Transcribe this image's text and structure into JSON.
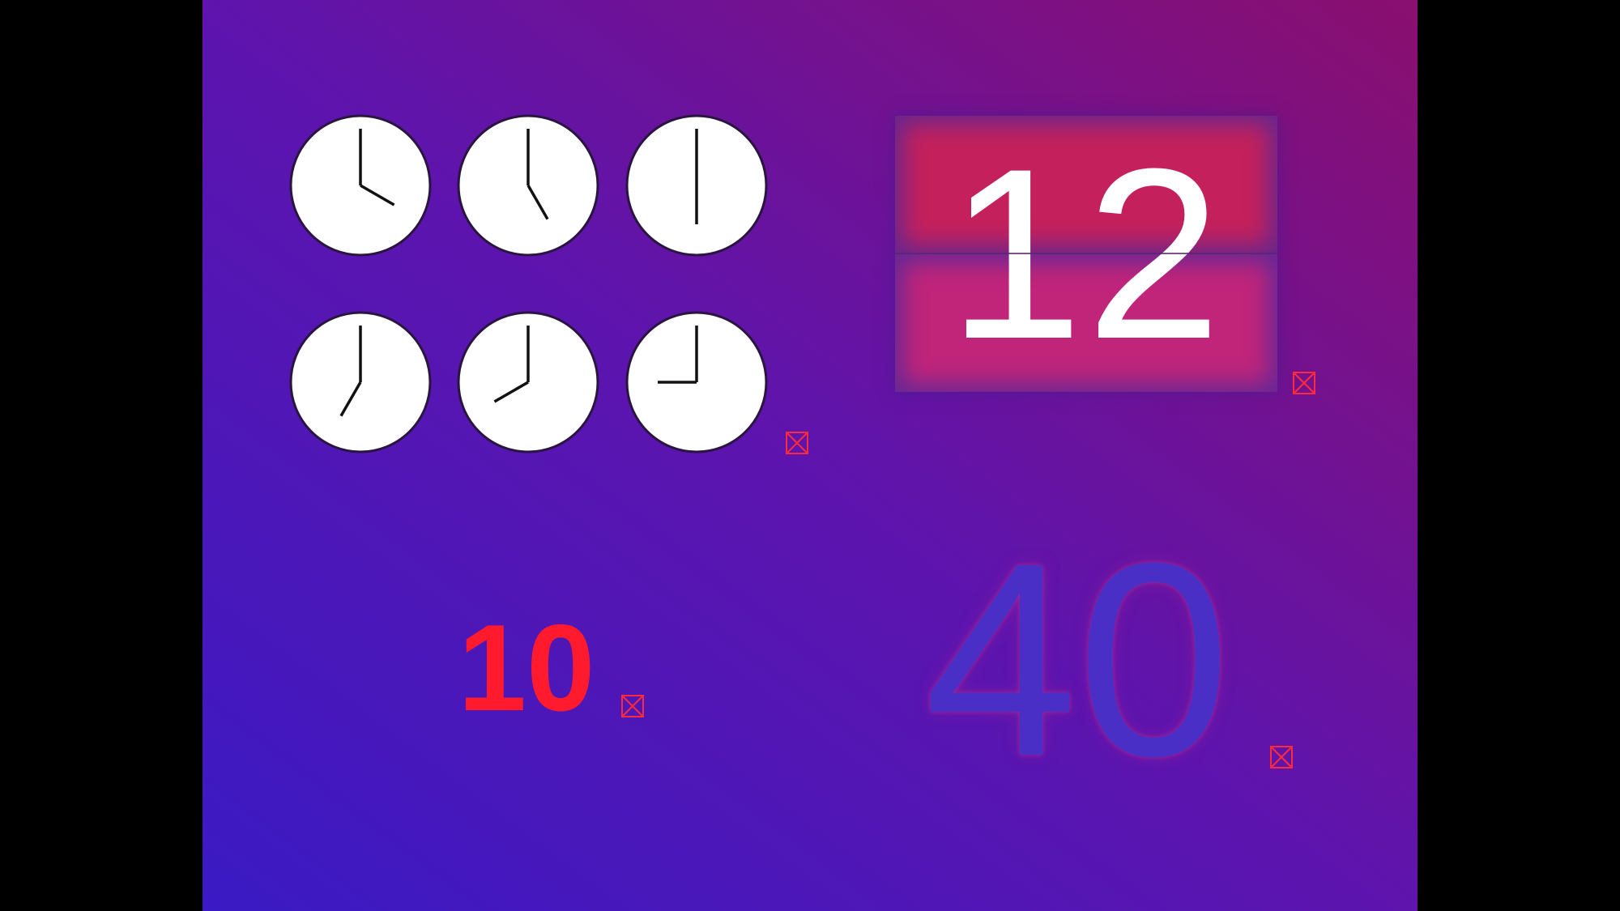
{
  "colors": {
    "letterbox": "#000000",
    "gradient_start": "#3a1ac4",
    "gradient_mid": "#5e14ad",
    "gradient_end": "#8a0f6f",
    "clock_face": "#ffffff",
    "clock_rim": "#2a1440",
    "clock_hand": "#111111",
    "flip_top": "#c4215c",
    "flip_bottom": "#c0257a",
    "flip_text": "#ffffff",
    "red_counter": "#ff1b2d",
    "blue_counter": "#4a2fc6",
    "broken_icon": "#ff2a3a"
  },
  "clocks": [
    {
      "label": "clock-1",
      "hour": 4,
      "minute": 0
    },
    {
      "label": "clock-2",
      "hour": 5,
      "minute": 0
    },
    {
      "label": "clock-3",
      "hour": 6,
      "minute": 0
    },
    {
      "label": "clock-4",
      "hour": 7,
      "minute": 0
    },
    {
      "label": "clock-5",
      "hour": 8,
      "minute": 0
    },
    {
      "label": "clock-6",
      "hour": 9,
      "minute": 0
    }
  ],
  "flip_counter": {
    "value": "12"
  },
  "red_counter": {
    "value": "10"
  },
  "blue_counter": {
    "value": "40"
  },
  "icons": {
    "broken_image": "broken-image-icon"
  }
}
